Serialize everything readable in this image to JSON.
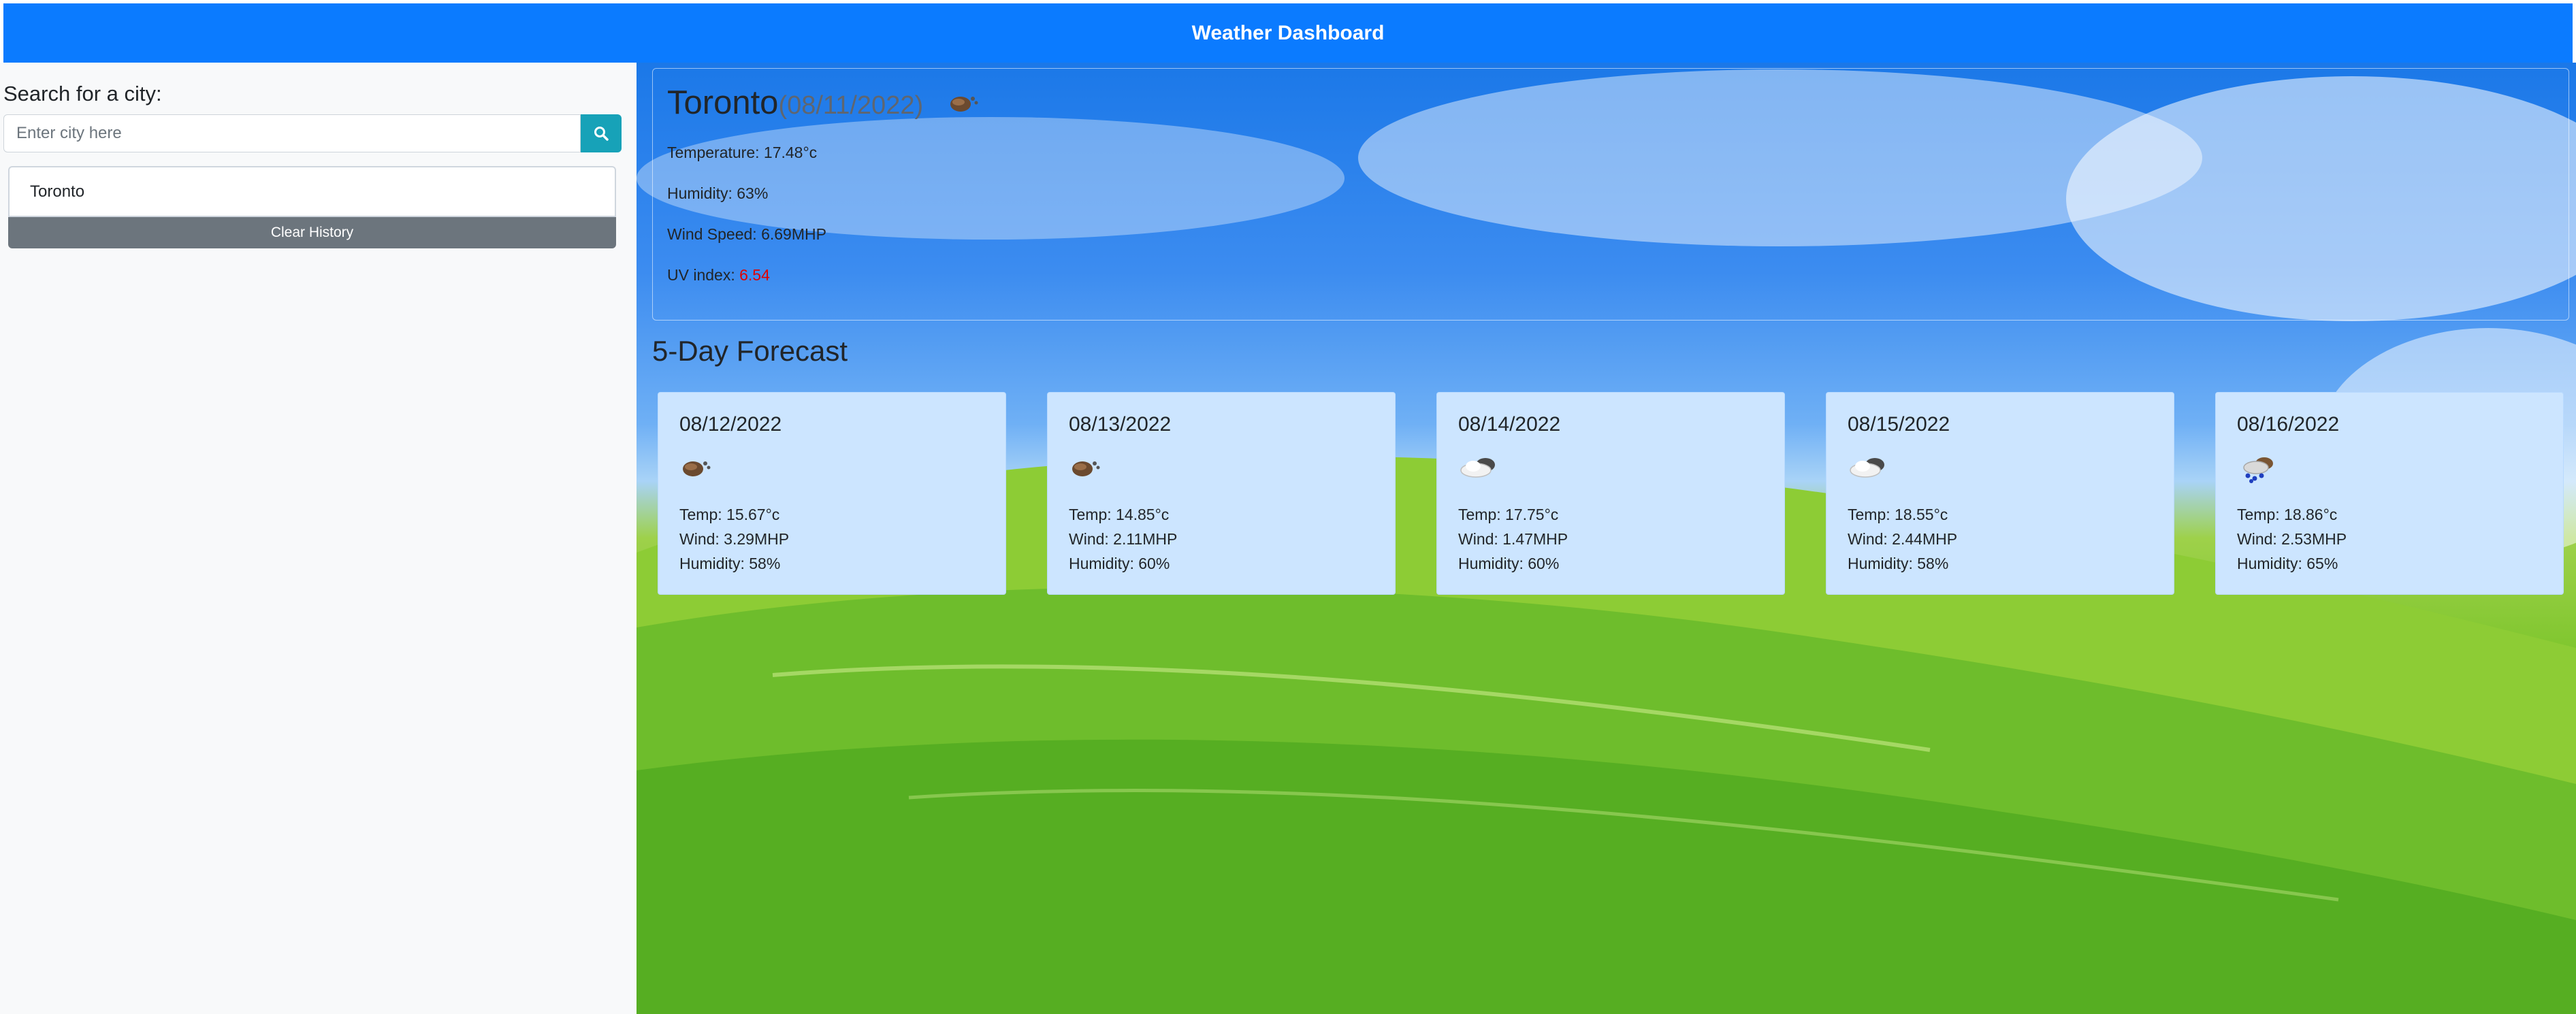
{
  "header": {
    "title": "Weather Dashboard"
  },
  "sidebar": {
    "search_label": "Search for a city:",
    "search_placeholder": "Enter city here",
    "search_value": "",
    "search_icon": "search-icon",
    "history": [
      "Toronto"
    ],
    "clear_label": "Clear History"
  },
  "current": {
    "city": "Toronto",
    "date": "(08/11/2022)",
    "icon": "broken-clouds-icon",
    "temperature": "Temperature: 17.48°c",
    "humidity": "Humidity: 63%",
    "wind": "Wind Speed: 6.69MHP",
    "uv_label": "UV index: ",
    "uv_value": "6.54",
    "uv_color": "#e00000"
  },
  "forecast": {
    "title": "5-Day Forecast",
    "days": [
      {
        "date": "08/12/2022",
        "icon": "broken-clouds-icon",
        "temp": "Temp: 15.67°c",
        "wind": "Wind: 3.29MHP",
        "humidity": "Humidity: 58%"
      },
      {
        "date": "08/13/2022",
        "icon": "broken-clouds-icon",
        "temp": "Temp: 14.85°c",
        "wind": "Wind: 2.11MHP",
        "humidity": "Humidity: 60%"
      },
      {
        "date": "08/14/2022",
        "icon": "cloud-icon",
        "temp": "Temp: 17.75°c",
        "wind": "Wind: 1.47MHP",
        "humidity": "Humidity: 60%"
      },
      {
        "date": "08/15/2022",
        "icon": "cloud-icon",
        "temp": "Temp: 18.55°c",
        "wind": "Wind: 2.44MHP",
        "humidity": "Humidity: 58%"
      },
      {
        "date": "08/16/2022",
        "icon": "rain-icon",
        "temp": "Temp: 18.86°c",
        "wind": "Wind: 2.53MHP",
        "humidity": "Humidity: 65%"
      }
    ]
  },
  "colors": {
    "header": "#0b7bff",
    "search_button": "#17a2b8",
    "clear_button": "#6c757d",
    "card": "#cce5ff",
    "uv_warning": "#e00000"
  }
}
